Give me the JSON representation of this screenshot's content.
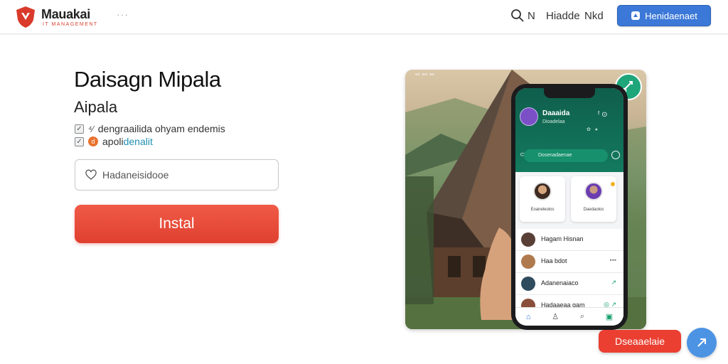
{
  "header": {
    "brand": "Mauakai",
    "brand_sub": "IT MANAGEMENT",
    "dots": "···",
    "nav": [
      "N",
      "Hiadde",
      "Nkd"
    ],
    "cta_label": "Henidaenaet"
  },
  "main": {
    "title": "Daisagn Mipala",
    "subtitle": "Aipala",
    "checks": [
      {
        "icon": "✓",
        "extra": "⁴⁄",
        "text": "dengraailida ohyam endemis"
      },
      {
        "icon": "✓",
        "extra": "d",
        "text": "apoli",
        "accent": "denalit"
      }
    ],
    "input_placeholder": "Hadaneisidooe",
    "install_label": "Instal"
  },
  "hero": {
    "mini": "ᵃᵒ ʷᵒ ᵃᵉ",
    "phone": {
      "app_title": "Daaaida",
      "app_sub": "Dioadelaa",
      "tools": "ᶠ ⊙",
      "tools2": "✿ ●",
      "search_text": "Dosenadaenae",
      "cards": [
        {
          "name": "Eoaneleolos"
        },
        {
          "name": "Daedaolos"
        }
      ],
      "list": [
        {
          "name": "Hagam Hisnan",
          "end": "",
          "color": "#5a3f36"
        },
        {
          "name": "Haa bdot",
          "end": "•••",
          "color": "#b07a4f"
        },
        {
          "name": "Adanenaiaco",
          "end": "↗",
          "color": "#2f4b5e"
        },
        {
          "name": "Hadaaeaa gam",
          "end": "◎ ↗",
          "color": "#8a4f3a"
        }
      ],
      "tabs": [
        "⌂",
        "♙",
        "⌕",
        "▣"
      ]
    }
  },
  "chat": {
    "pill_label": "Dseaaelaie"
  },
  "colors": {
    "primary_blue": "#3b78d8",
    "install_red": "#e0402f",
    "app_green": "#137a5e",
    "chat_blue": "#4d93e3"
  }
}
